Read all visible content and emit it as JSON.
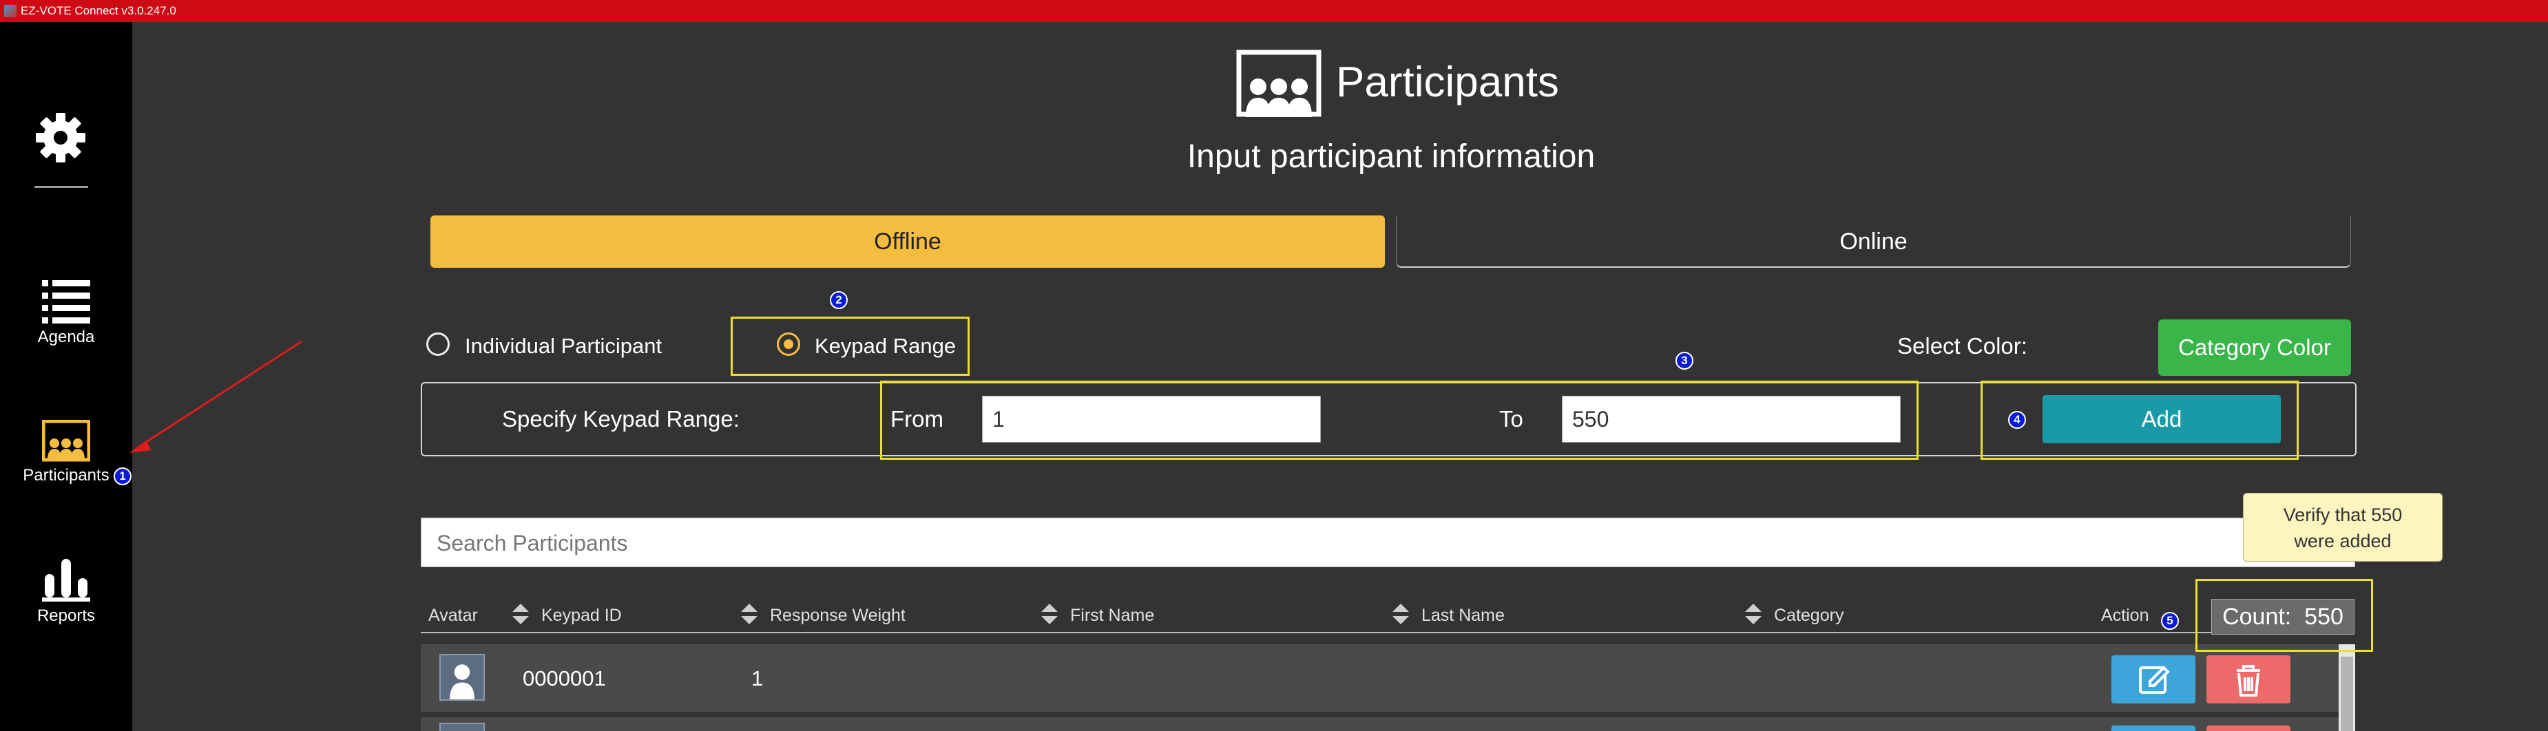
{
  "window": {
    "title": "EZ-VOTE Connect v3.0.247.0"
  },
  "sidebar": {
    "items": [
      {
        "label": "Agenda",
        "icon": "list-icon"
      },
      {
        "label": "Participants",
        "icon": "participants-icon"
      },
      {
        "label": "Reports",
        "icon": "bar-chart-icon"
      }
    ]
  },
  "header": {
    "title": "Participants",
    "subtitle": "Input participant information"
  },
  "tabs": [
    {
      "label": "Offline",
      "active": true
    },
    {
      "label": "Online",
      "active": false
    }
  ],
  "mode": {
    "individual_label": "Individual Participant",
    "range_label": "Keypad Range",
    "selected": "Keypad Range"
  },
  "color": {
    "select_label": "Select Color:",
    "button_label": "Category Color"
  },
  "range": {
    "label": "Specify Keypad Range:",
    "from_label": "From",
    "from_value": "1",
    "to_label": "To",
    "to_value": "550",
    "add_label": "Add"
  },
  "search": {
    "placeholder": "Search Participants"
  },
  "tooltip": {
    "line1": "Verify that 550",
    "line2": "were added"
  },
  "table": {
    "columns": [
      "Avatar",
      "Keypad ID",
      "Response Weight",
      "First Name",
      "Last Name",
      "Category",
      "Action"
    ],
    "count_label": "Count:",
    "count_value": "550",
    "rows": [
      {
        "keypad_id": "0000001",
        "response_weight": "1",
        "first_name": "",
        "last_name": "",
        "category": ""
      }
    ]
  },
  "callouts": [
    "1",
    "2",
    "3",
    "4",
    "5"
  ],
  "colors": {
    "accent": "#f5bd3f",
    "add_button": "#1a9aa6",
    "category_button": "#39b54a",
    "edit": "#3da5d9",
    "delete": "#ec6a6a",
    "titlebar": "#cc0b14",
    "highlight": "#e9e02a",
    "callout": "#0a1bd6"
  }
}
